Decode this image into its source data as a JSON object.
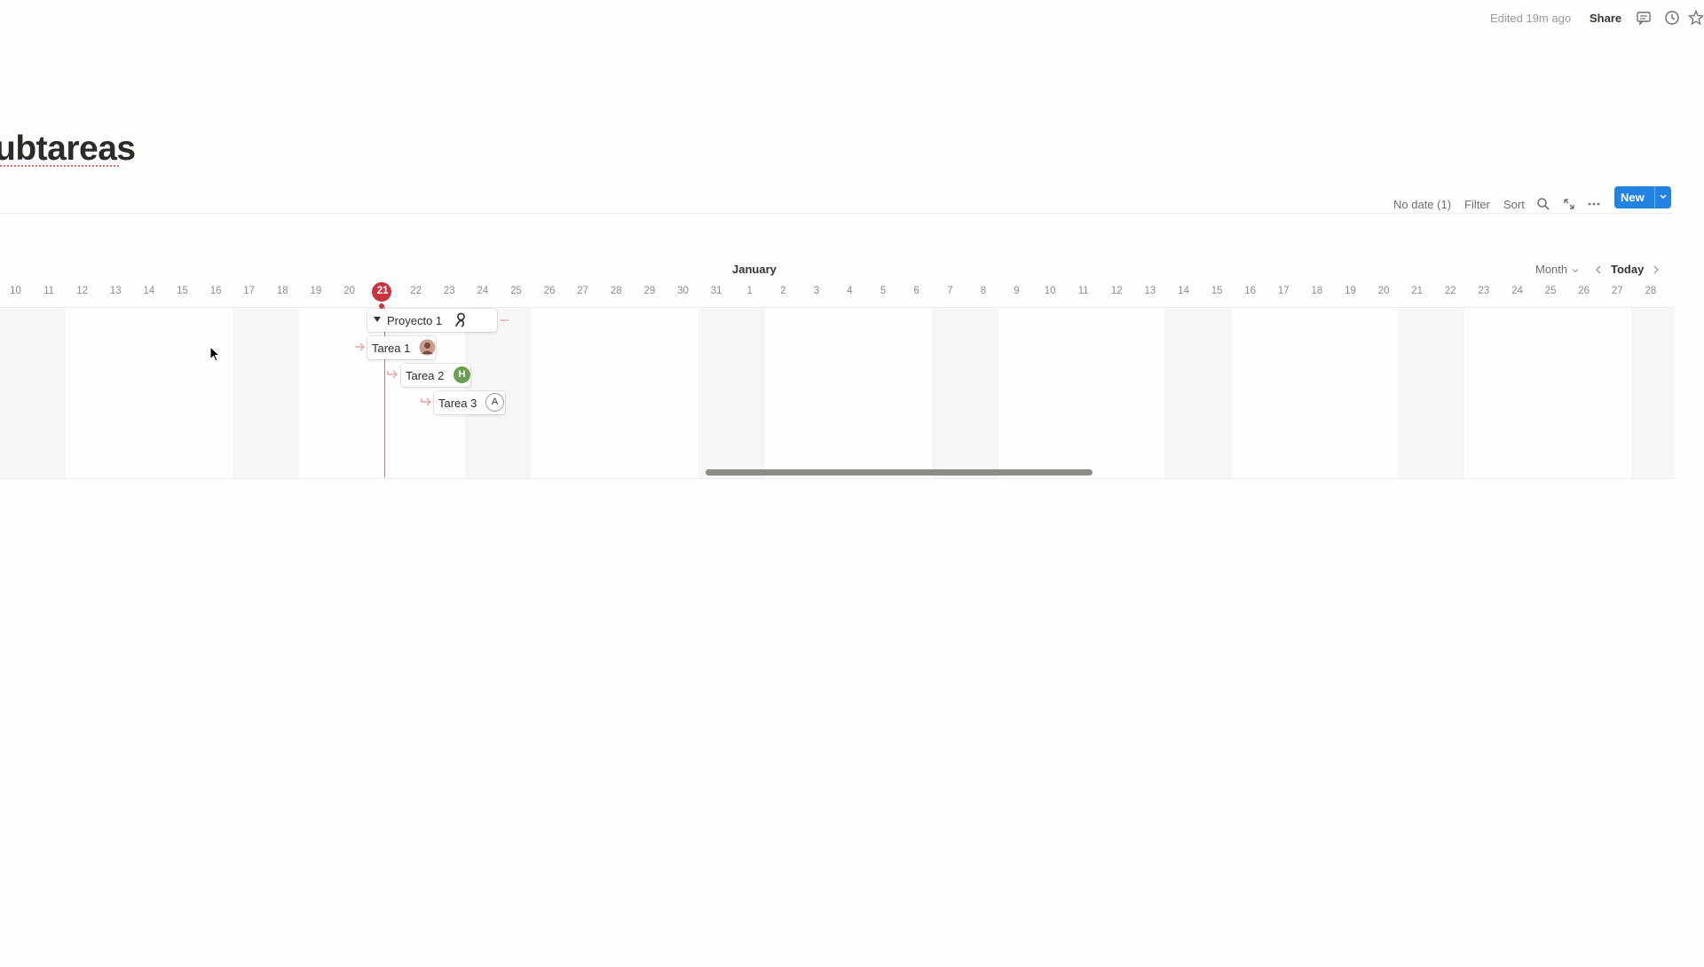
{
  "header": {
    "edited": "Edited 19m ago",
    "share": "Share",
    "icons": [
      "comment-icon",
      "clock-icon",
      "star-icon"
    ]
  },
  "page": {
    "title": "ubtareas"
  },
  "toolbar": {
    "no_date": "No date (1)",
    "filter": "Filter",
    "sort": "Sort",
    "new_label": "New",
    "icons": [
      "search-icon",
      "expand-icon",
      "more-icon"
    ],
    "accent": "#2383e2"
  },
  "timeline": {
    "month_label": "January",
    "view": "Month",
    "today_label": "Today",
    "today_day": "21",
    "today_color": "#c7343f",
    "days": [
      "10",
      "11",
      "12",
      "13",
      "14",
      "15",
      "16",
      "17",
      "18",
      "19",
      "20",
      "21",
      "22",
      "23",
      "24",
      "25",
      "26",
      "27",
      "28",
      "29",
      "30",
      "31",
      "1",
      "2",
      "3",
      "4",
      "5",
      "6",
      "7",
      "8",
      "9",
      "10",
      "11",
      "12",
      "13",
      "14",
      "15",
      "16",
      "17",
      "18",
      "19",
      "20",
      "21",
      "22",
      "23",
      "24",
      "25",
      "26",
      "27",
      "28"
    ]
  },
  "items": [
    {
      "name": "Proyecto 1",
      "avatar": "photo"
    },
    {
      "name": "Tarea 1",
      "avatar": "photo"
    },
    {
      "name": "Tarea 2",
      "avatar": "H",
      "avatar_color": "#6d9e55"
    },
    {
      "name": "Tarea 3",
      "avatar": "A"
    }
  ]
}
